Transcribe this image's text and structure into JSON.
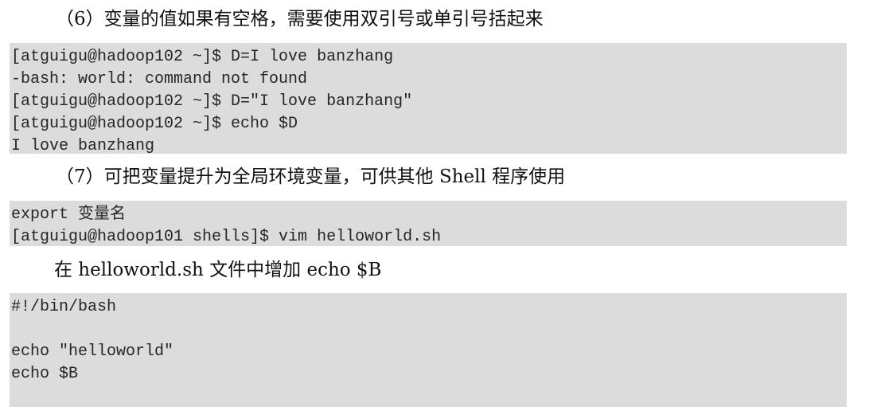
{
  "sections": [
    {
      "heading": "（6）变量的值如果有空格，需要使用双引号或单引号括起来",
      "code": [
        "[atguigu@hadoop102 ~]$ D=I love banzhang",
        "-bash: world: command not found",
        "[atguigu@hadoop102 ~]$ D=\"I love banzhang\"",
        "[atguigu@hadoop102 ~]$ echo $D",
        "I love banzhang"
      ]
    },
    {
      "heading": "（7）可把变量提升为全局环境变量，可供其他 Shell 程序使用",
      "code": [
        "export 变量名",
        "[atguigu@hadoop101 shells]$ vim helloworld.sh"
      ]
    },
    {
      "heading": "在 helloworld.sh 文件中增加 echo $B",
      "code": [
        "#!/bin/bash",
        "",
        "echo \"helloworld\"",
        "echo $B"
      ]
    }
  ]
}
